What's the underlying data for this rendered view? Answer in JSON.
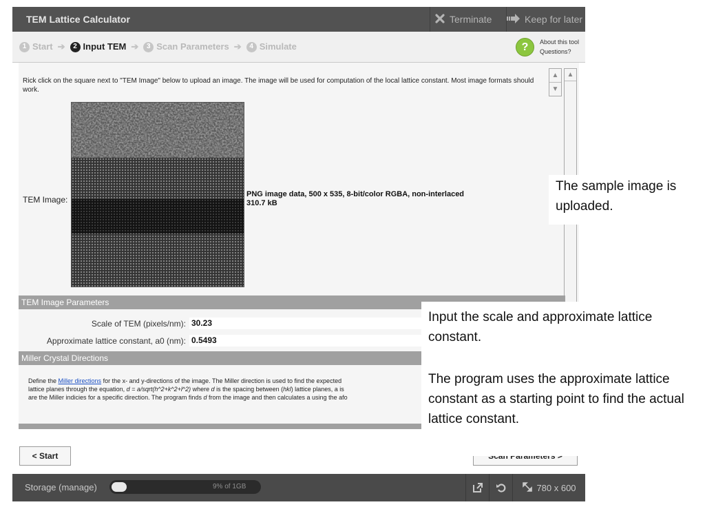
{
  "window": {
    "title": "TEM Lattice Calculator",
    "terminate_label": "Terminate",
    "keep_later_label": "Keep for later"
  },
  "steps": [
    {
      "num": "1",
      "label": "Start"
    },
    {
      "num": "2",
      "label": "Input TEM"
    },
    {
      "num": "3",
      "label": "Scan Parameters"
    },
    {
      "num": "4",
      "label": "Simulate"
    }
  ],
  "current_step": 2,
  "help": {
    "about_label": "About this tool",
    "questions_label": "Questions?"
  },
  "content": {
    "instructions": "Rick click on the square next to \"TEM Image\" below to upload an image. The image will be used for computation of the local lattice constant. Most image formats should work.",
    "tem_image_label": "TEM Image:",
    "image_info_line1": "PNG image data, 500 x 535, 8-bit/color RGBA, non-interlaced",
    "image_info_line2": "310.7 kB"
  },
  "params": {
    "section_title": "TEM Image Parameters",
    "scale_label": "Scale of TEM (pixels/nm):",
    "scale_value": "30.23",
    "lattice_label": "Approximate lattice constant, a0 (nm):",
    "lattice_value": "0.5493"
  },
  "miller": {
    "section_title": "Miller Crystal Directions",
    "text_before_link": "Define the ",
    "link_text": "Miller directions",
    "text_after_link": " for the x- and y-directions of the image. The Miller direction is used to find the expected",
    "line2_a": "lattice planes through the equation, ",
    "line2_eq": "d = a/sqrt(h^2+k^2+l^2)",
    "line2_b": " where ",
    "line2_d": "d",
    "line2_c": " is the spacing between (",
    "line2_hkl": "hkl",
    "line2_e": ") lattice planes, a is",
    "line3_a": "are the Miller indicies for a specific direction. The program finds ",
    "line3_d": "d",
    "line3_b": " from the image and then calculates a using the afo"
  },
  "nav": {
    "back_label": "< Start",
    "next_label": "Scan Parameters >"
  },
  "status": {
    "storage_label": "Storage (manage)",
    "storage_pct_text": "9% of 1GB",
    "storage_fraction": 0.09,
    "window_size": "780 x 600"
  },
  "callouts": {
    "uploaded": "The sample image is uploaded.",
    "input_scale": "Input the scale and approximate lattice constant.",
    "starting_point": "The program uses the approximate lattice constant as a starting point to find the actual lattice constant."
  },
  "colors": {
    "titlebar": "#525252",
    "help_green": "#8cc63f",
    "section_gray": "#a0a0a0",
    "link_blue": "#1a4fc4"
  }
}
